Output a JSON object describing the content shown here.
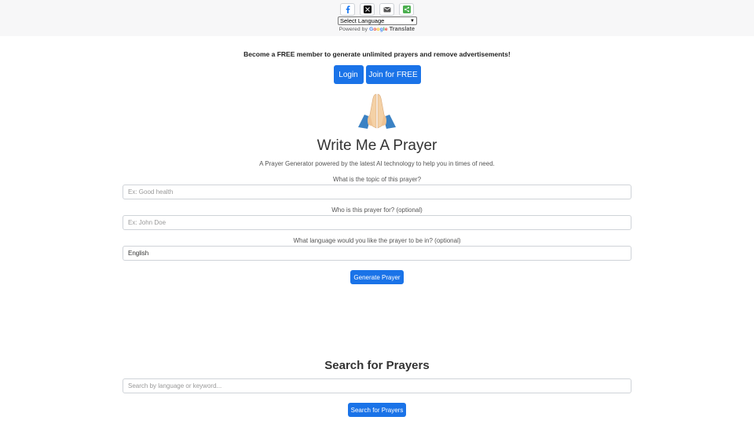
{
  "share": {
    "buttons": [
      {
        "name": "facebook",
        "color": "#1877f2"
      },
      {
        "name": "x",
        "color": "#000000"
      },
      {
        "name": "email",
        "color": "#555555"
      },
      {
        "name": "sharethis",
        "color": "#4caf50"
      }
    ]
  },
  "translate": {
    "select_label": "Select Language",
    "powered_prefix": "Powered by",
    "google": "Google",
    "translate_word": "Translate"
  },
  "membership": {
    "text": "Become a FREE member to generate unlimited prayers and remove advertisements!",
    "login_label": "Login",
    "join_label": "Join for FREE"
  },
  "hero": {
    "icon": "praying-hands-icon",
    "title": "Write Me A Prayer",
    "subtitle": "A Prayer Generator powered by the latest AI technology to help you in times of need."
  },
  "form": {
    "topic_label": "What is the topic of this prayer?",
    "topic_placeholder": "Ex: Good health",
    "who_label": "Who is this prayer for? (optional)",
    "who_placeholder": "Ex: John Doe",
    "language_label": "What language would you like the prayer to be in? (optional)",
    "language_value": "English",
    "generate_label": "Generate Prayer"
  },
  "search": {
    "title": "Search for Prayers",
    "placeholder": "Search by language or keyword...",
    "button_label": "Search for Prayers"
  },
  "colors": {
    "accent": "#1a73e8",
    "topbar": "#f7f7f8"
  }
}
